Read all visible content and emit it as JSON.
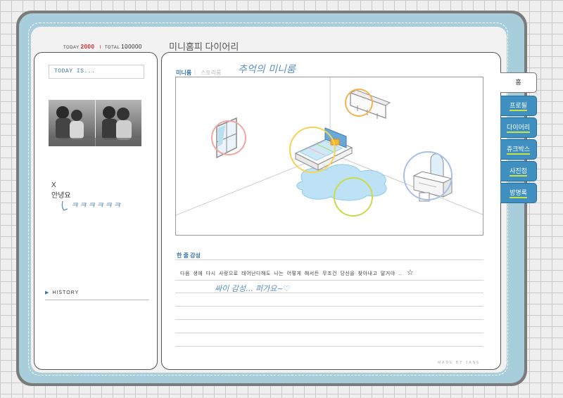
{
  "header": {
    "today_label": "TODAY",
    "today_value": "2000",
    "separator": "I",
    "total_label": "TOTAL",
    "total_value": "100000",
    "title": "미니홈피 다이어리"
  },
  "sidebar": {
    "today_is": "TODAY IS...",
    "profile_lines": [
      "X",
      "안녕요"
    ],
    "handwriting": "ㅋㅋㅋㅋㅋㅋ",
    "history_label": "HISTORY"
  },
  "main": {
    "tabs": [
      {
        "label": "미니룸"
      },
      {
        "label": "스토리룸"
      }
    ],
    "tab_separator": "|",
    "handwritten_title": "추억의 미니룸",
    "section_title": "한 줄 감성",
    "diary_line": "다음 생에 다시 사랑으로 태어난다해도  나는 어떻게 해서든 무조건 당신을 찾아내고 말거야 ..",
    "handwritten_reply": "싸이 감성... 퍼가요~♡",
    "made_by": "MADE BY JANE"
  },
  "menu": {
    "items": [
      {
        "label": "홈",
        "active": true
      },
      {
        "label": "프로필",
        "active": false
      },
      {
        "label": "다이어리",
        "active": false
      },
      {
        "label": "쥬크박스",
        "active": false
      },
      {
        "label": "사진첩",
        "active": false
      },
      {
        "label": "방명록",
        "active": false
      }
    ]
  },
  "colors": {
    "frame": "#a8cedb",
    "accent": "#3b78a8",
    "menu_tab": "#3f8fc0",
    "menu_underline": "#c8e34a",
    "counter_red": "#e52222",
    "handwriting": "#5b8fc4"
  }
}
